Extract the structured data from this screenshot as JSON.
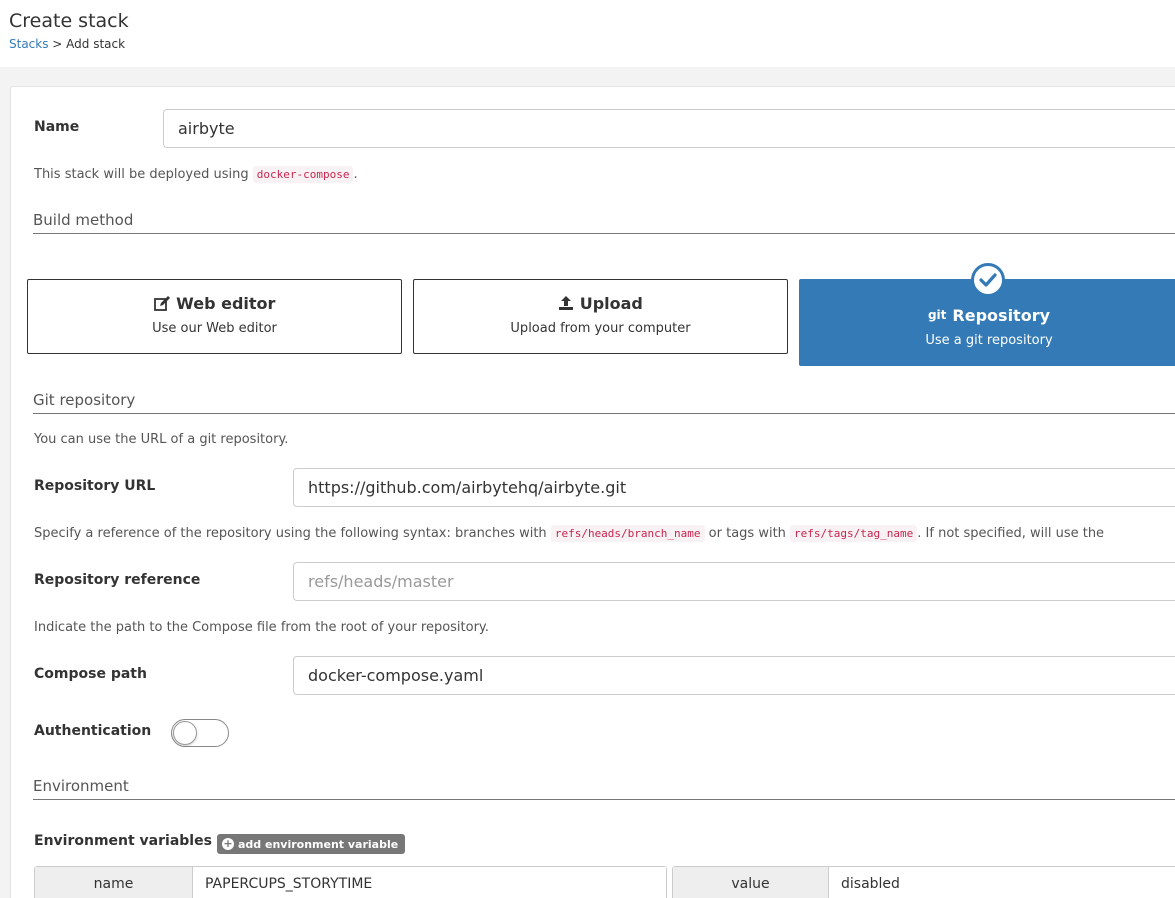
{
  "header": {
    "title": "Create stack",
    "breadcrumb_link": "Stacks",
    "breadcrumb_sep": " > ",
    "breadcrumb_current": "Add stack"
  },
  "name_field": {
    "label": "Name",
    "value": "airbyte"
  },
  "deploy_note": {
    "prefix": "This stack will be deployed using",
    "code": "docker-compose",
    "suffix": "."
  },
  "build_method": {
    "title": "Build method",
    "options": [
      {
        "title": "Web editor",
        "desc": "Use our Web editor",
        "icon": "edit-icon",
        "active": false
      },
      {
        "title": "Upload",
        "desc": "Upload from your computer",
        "icon": "upload-icon",
        "active": false
      },
      {
        "title": "Repository",
        "desc": "Use a git repository",
        "icon": "git-icon",
        "icon_text": "git",
        "active": true
      }
    ]
  },
  "git": {
    "title": "Git repository",
    "help": "You can use the URL of a git repository.",
    "url_label": "Repository URL",
    "url_value": "https://github.com/airbytehq/airbyte.git",
    "ref_help_1": "Specify a reference of the repository using the following syntax: branches with",
    "ref_code_1": "refs/heads/branch_name",
    "ref_help_2": "or tags with",
    "ref_code_2": "refs/tags/tag_name",
    "ref_help_3": ". If not specified, will use the",
    "ref_label": "Repository reference",
    "ref_placeholder": "refs/heads/master",
    "compose_help": "Indicate the path to the Compose file from the root of your repository.",
    "compose_label": "Compose path",
    "compose_value": "docker-compose.yaml",
    "auth_label": "Authentication",
    "auth_enabled": false
  },
  "environment": {
    "title": "Environment",
    "vars_label": "Environment variables",
    "add_label": "add environment variable",
    "rows": [
      {
        "name_label": "name",
        "name": "PAPERCUPS_STORYTIME",
        "value_label": "value",
        "value": "disabled"
      }
    ]
  },
  "colors": {
    "primary": "#337ab7",
    "code": "#c7254e",
    "badge": "#777777"
  }
}
